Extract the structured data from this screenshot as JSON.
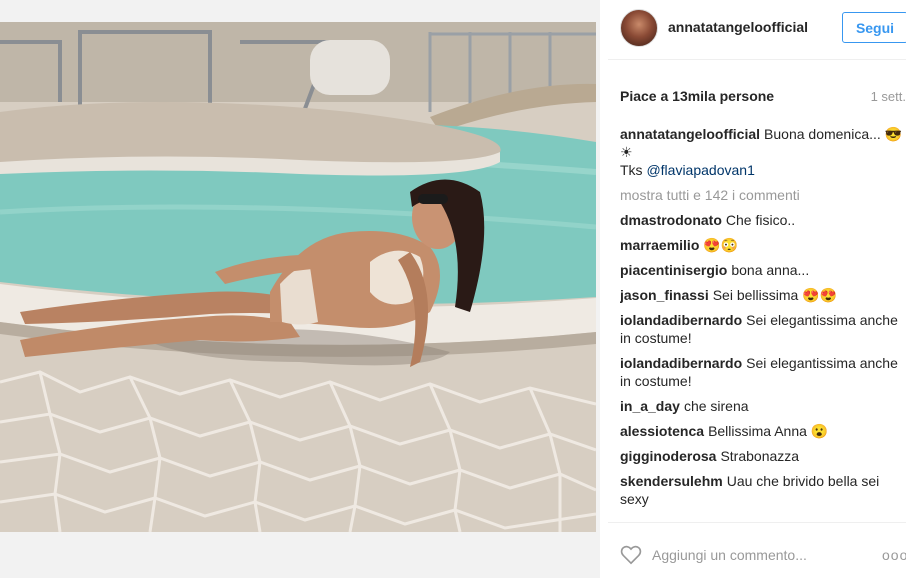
{
  "post": {
    "image_alt": "Woman lying on pool deck in crochet bikini",
    "username": "annatatangeloofficial",
    "follow_label": "Segui",
    "likes_text": "Piace a 13mila persone",
    "date_text": "1 sett."
  },
  "caption": {
    "user": "annatatangeloofficial",
    "text": "Buona domenica... 😎☀",
    "thanks_prefix": "Tks",
    "mention": "@flaviapadovan1"
  },
  "show_all_comments": "mostra tutti e 142 i commenti",
  "comments": [
    {
      "user": "dmastrodonato",
      "text": "Che fisico.."
    },
    {
      "user": "marraemilio",
      "text": "😍😳"
    },
    {
      "user": "piacentinisergio",
      "text": "bona anna..."
    },
    {
      "user": "jason_finassi",
      "text": "Sei bellissima 😍😍"
    },
    {
      "user": "iolandadibernardo",
      "text": "Sei elegantissima anche in costume!"
    },
    {
      "user": "iolandadibernardo",
      "text": "Sei elegantissima anche in costume!"
    },
    {
      "user": "in_a_day",
      "text": "che sirena"
    },
    {
      "user": "alessiotenca",
      "text": "Bellissima Anna 😮"
    },
    {
      "user": "gigginoderosa",
      "text": "Strabonazza"
    },
    {
      "user": "skendersulehm",
      "text": "Uau che brivido bella sei sexy"
    }
  ],
  "footer": {
    "comment_placeholder": "Aggiungi un commento...",
    "more_label": "ooo",
    "like_icon": "heart-outline-icon"
  },
  "colors": {
    "accent": "#3897f0",
    "text": "#262626",
    "muted": "#999999"
  }
}
